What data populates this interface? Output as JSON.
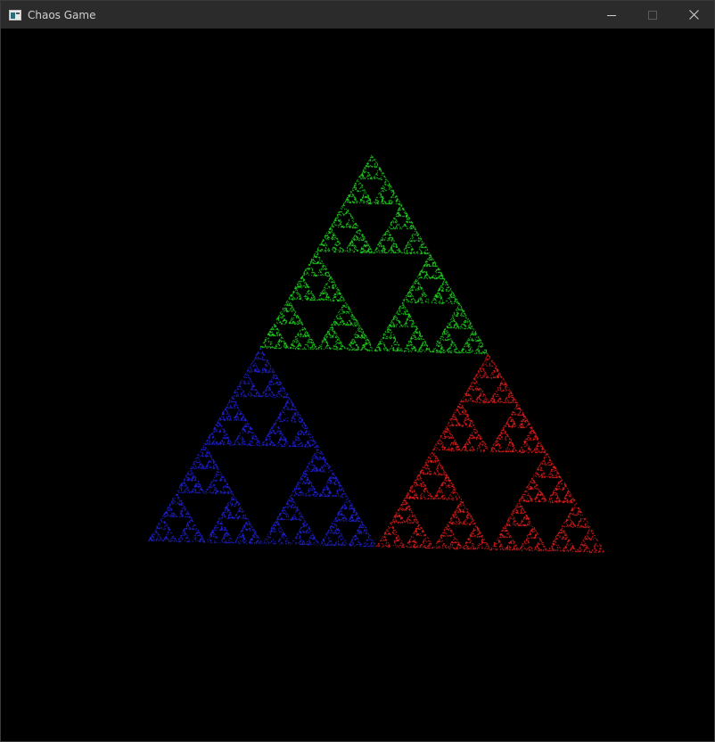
{
  "window": {
    "title": "Chaos Game",
    "icon": "app-window-icon",
    "controls": {
      "minimize_icon": "minimize-icon",
      "maximize_icon": "maximize-icon",
      "close_icon": "close-icon",
      "maximize_enabled": false
    },
    "titlebar_color": "#2b2b2b",
    "title_color": "#cfcfcf"
  },
  "canvas": {
    "background": "#000000",
    "fractal": "sierpinski-triangle",
    "subtriangle_colors": {
      "top": "#1fd11f",
      "bottom_left": "#2020d8",
      "bottom_right": "#dd1c1c"
    }
  }
}
